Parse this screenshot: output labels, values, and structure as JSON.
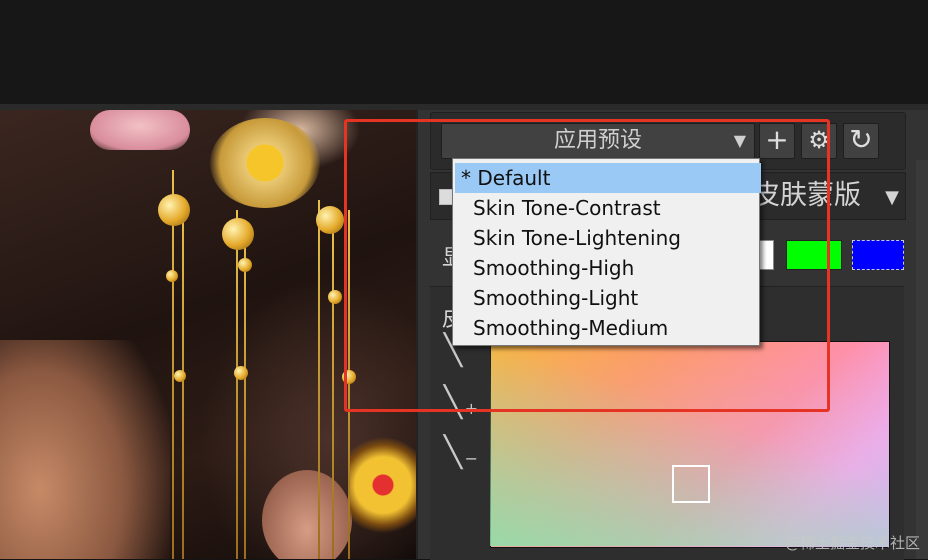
{
  "preset": {
    "select_label": "应用预设",
    "caret": "▼",
    "add_icon": "+",
    "settings_icon": "⚙",
    "refresh_icon": "↻"
  },
  "mask": {
    "label": "皮肤蒙版",
    "caret": "▼"
  },
  "show_row": {
    "label": "显",
    "swatches": [
      "#ffffff",
      "#00ff00",
      "#0000ff"
    ]
  },
  "skin_section": {
    "label": "皮",
    "dropper_plus": "+",
    "dropper_minus": "−"
  },
  "dropdown": {
    "options": [
      "* Default",
      "Skin Tone-Contrast",
      "Skin Tone-Lightening",
      "Smoothing-High",
      "Smoothing-Light",
      "Smoothing-Medium"
    ],
    "selected_index": 0
  },
  "watermark": "@稀土掘金技术社区",
  "colors": {
    "highlight": "#e53324",
    "selection": "#99c9f4"
  }
}
